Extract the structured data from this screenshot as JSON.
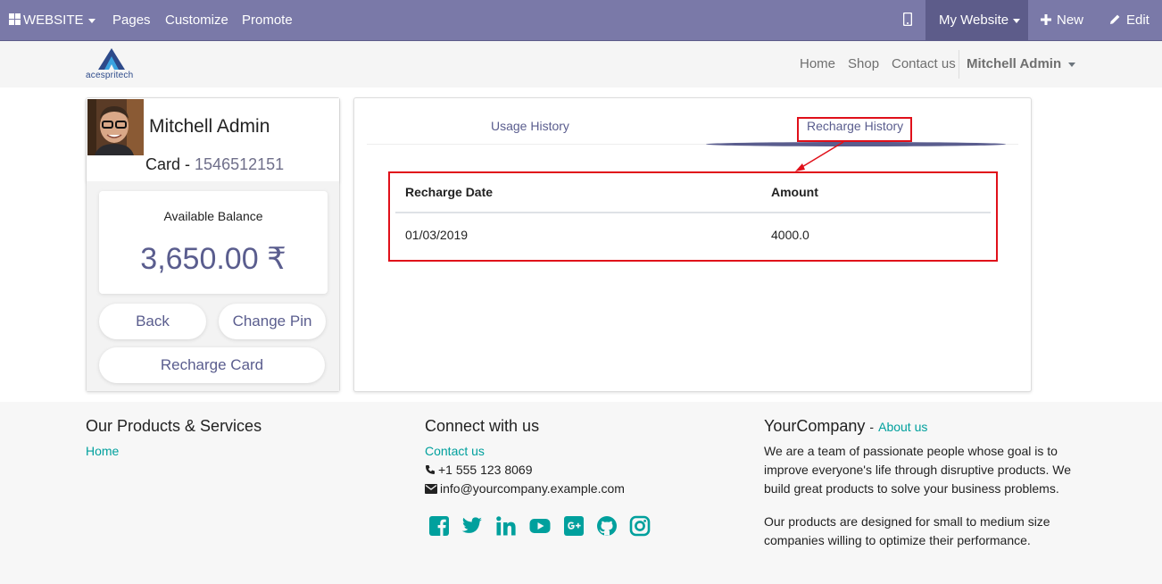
{
  "topbar": {
    "website_menu": "WEBSITE",
    "pages": "Pages",
    "customize": "Customize",
    "promote": "Promote",
    "my_website": "My Website",
    "new": "New",
    "edit": "Edit"
  },
  "header": {
    "logo_text": "acespritech",
    "nav": {
      "home": "Home",
      "shop": "Shop",
      "contact": "Contact us",
      "user": "Mitchell Admin"
    }
  },
  "profile": {
    "name": "Mitchell Admin",
    "card_label": "Card -",
    "card_number": "1546512151",
    "balance_label": "Available Balance",
    "balance_amount": "3,650.00 ₹",
    "back_button": "Back",
    "change_pin_button": "Change Pin",
    "recharge_button": "Recharge Card"
  },
  "history": {
    "tabs": [
      "Usage History",
      "Recharge History"
    ],
    "active_tab": "Recharge History",
    "columns": [
      "Recharge Date",
      "Amount"
    ],
    "rows": [
      [
        "01/03/2019",
        "4000.0"
      ]
    ]
  },
  "footer": {
    "products_title": "Our Products & Services",
    "products_link": "Home",
    "connect_title": "Connect with us",
    "contact_link": "Contact us",
    "phone": "+1 555 123 8069",
    "email": "info@yourcompany.example.com",
    "company_title": "YourCompany",
    "about_link": "About us",
    "about_text_1": "We are a team of passionate people whose goal is to improve everyone's life through disruptive products. We build great products to solve your business problems.",
    "about_text_2": "Our products are designed for small to medium size companies willing to optimize their performance.",
    "social_icons": [
      "facebook-icon",
      "twitter-icon",
      "linkedin-icon",
      "youtube-icon",
      "google-plus-icon",
      "github-icon",
      "instagram-icon"
    ]
  },
  "colors": {
    "topbar": "#7a79a8",
    "accent": "#5a5d8e",
    "teal": "#00a09d",
    "highlight": "#e0101a"
  }
}
